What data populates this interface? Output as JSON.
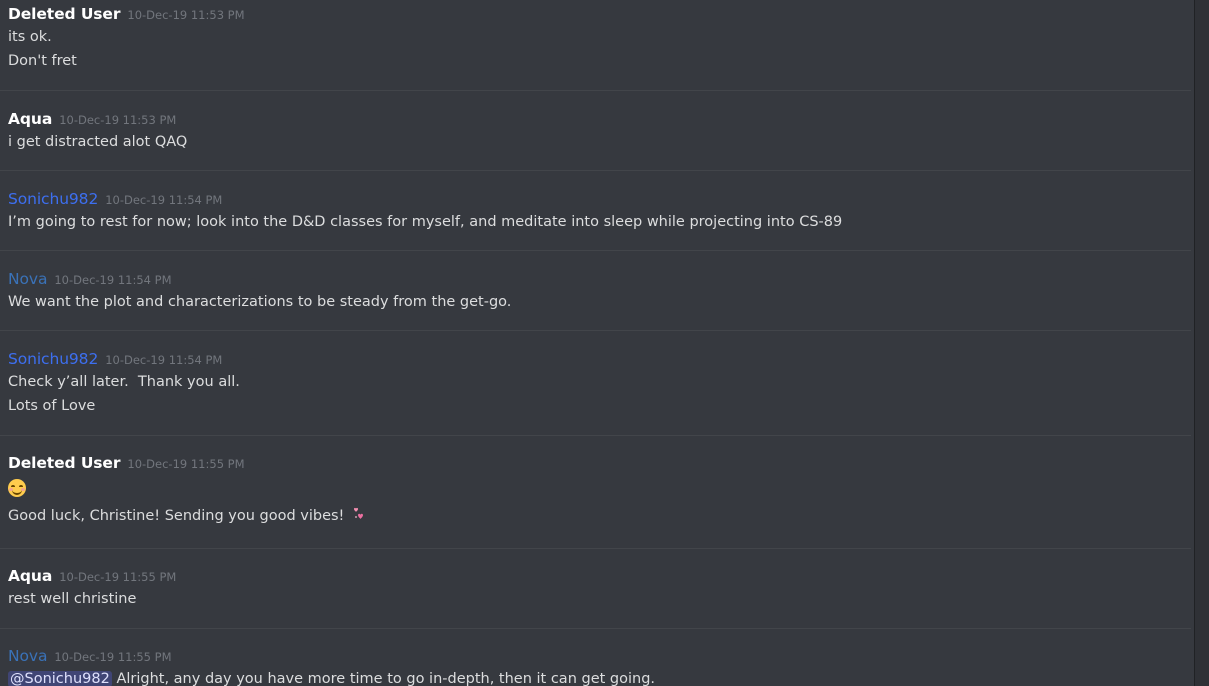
{
  "colors": {
    "background": "#36393f",
    "text": "#dcddde",
    "timestamp": "#72767d",
    "author_default": "#ffffff",
    "author_sonichu": "#3d6ff0",
    "author_nova": "#3a72b8",
    "mention_bg": "#4a4f86",
    "mention_text": "#c9cdfb"
  },
  "messages": [
    {
      "author": "Deleted User",
      "author_color": "#ffffff",
      "timestamp": "10-Dec-19 11:53 PM",
      "lines": [
        "its ok.",
        "Don't fret"
      ]
    },
    {
      "author": "Aqua",
      "author_color": "#ffffff",
      "timestamp": "10-Dec-19 11:53 PM",
      "lines": [
        "i get distracted alot QAQ"
      ]
    },
    {
      "author": "Sonichu982",
      "author_color": "#3d6ff0",
      "timestamp": "10-Dec-19 11:54 PM",
      "lines": [
        "I’m going to rest for now; look into the D&D classes for myself, and meditate into sleep while projecting into CS-89"
      ]
    },
    {
      "author": "Nova",
      "author_color": "#3a72b8",
      "timestamp": "10-Dec-19 11:54 PM",
      "lines": [
        "We want the plot and characterizations to be steady from the get-go."
      ]
    },
    {
      "author": "Sonichu982",
      "author_color": "#3d6ff0",
      "timestamp": "10-Dec-19 11:54 PM",
      "lines": [
        "Check y’all later.  Thank you all.",
        "Lots of Love"
      ]
    },
    {
      "author": "Deleted User",
      "author_color": "#ffffff",
      "timestamp": "10-Dec-19 11:55 PM",
      "emoji": "smiling-face-with-smiling-eyes",
      "lines": [
        "Good luck, Christine! Sending you good vibes!"
      ],
      "trailing_icon": "revolving-hearts"
    },
    {
      "author": "Aqua",
      "author_color": "#ffffff",
      "timestamp": "10-Dec-19 11:55 PM",
      "lines": [
        "rest well christine"
      ]
    },
    {
      "author": "Nova",
      "author_color": "#3a72b8",
      "timestamp": "10-Dec-19 11:55 PM",
      "mention": "@Sonichu982",
      "lines": [
        "Alright, any day you have more time to go in-depth, then it can get going."
      ]
    }
  ]
}
